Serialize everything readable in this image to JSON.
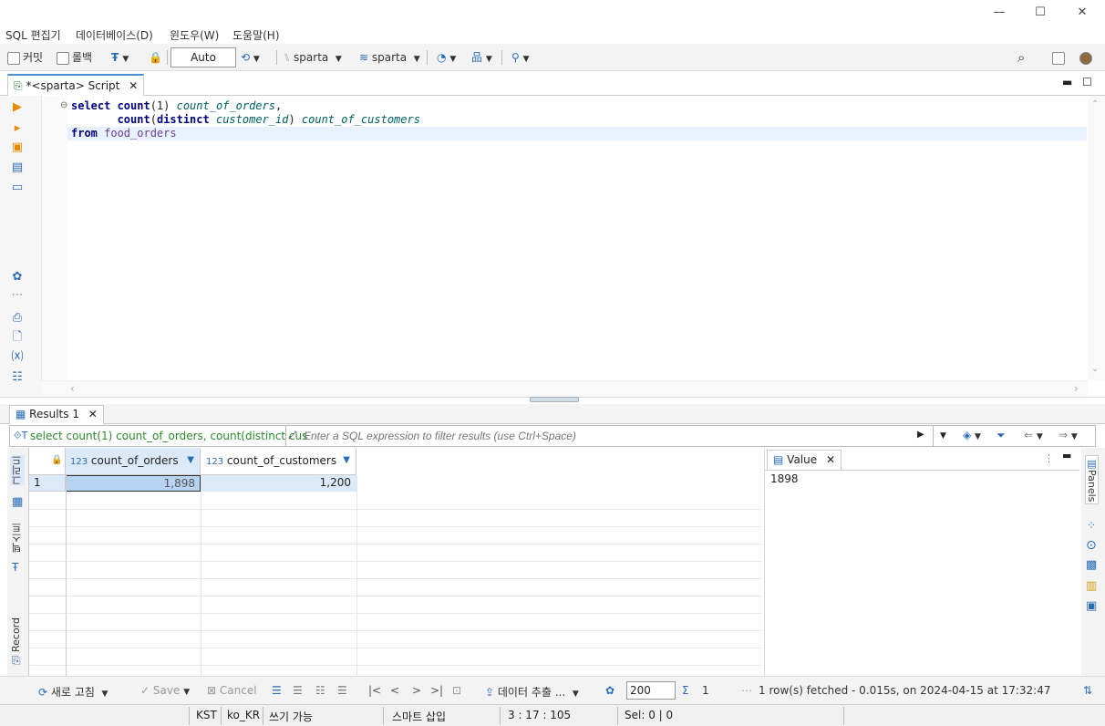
{
  "window": {
    "minimize": "—",
    "maximize": "☐",
    "close": "✕"
  },
  "menu": [
    "SQL 편집기",
    "데이터베이스(D)",
    "윈도우(W)",
    "도움말(H)"
  ],
  "toolbar": {
    "commit": "커밋",
    "rollback": "롤백",
    "mode": "Auto",
    "datasource": "sparta",
    "schema": "sparta"
  },
  "editor": {
    "tab_title": "*<sparta> Script",
    "lines": [
      {
        "kw1": "select ",
        "fn": "count",
        "args": "(1) ",
        "alias": "count_of_orders",
        "tail": ","
      },
      {
        "indent": "       ",
        "fn": "count",
        "paren": "(",
        "kw": "distinct ",
        "col": "customer_id",
        "close": ") ",
        "alias": "count_of_customers"
      },
      {
        "kw": "from ",
        "table": "food_orders"
      }
    ]
  },
  "results": {
    "tab_title": "Results 1",
    "filter_query": "select count(1) count_of_orders, count(distinct cus",
    "filter_placeholder": "Enter a SQL expression to filter results (use Ctrl+Space)",
    "columns": [
      {
        "type": "123",
        "name": "count_of_orders"
      },
      {
        "type": "123",
        "name": "count_of_customers"
      }
    ],
    "rows": [
      {
        "num": "1",
        "values": [
          "1,898",
          "1,200"
        ]
      }
    ],
    "side_tabs": [
      "그리드",
      "텍스트",
      "Record"
    ]
  },
  "value_panel": {
    "title": "Value",
    "value": "1898",
    "panels_label": "Panels"
  },
  "bottom": {
    "refresh": "새로 고침",
    "save": "Save",
    "cancel": "Cancel",
    "export": "데이터 추출 ...",
    "fetch_size": "200",
    "count": "1",
    "fetch_status": "1 row(s) fetched - 0.015s, on 2024-04-15 at 17:32:47"
  },
  "status": {
    "tz": "KST",
    "locale": "ko_KR",
    "writable": "쓰기 가능",
    "insert_mode": "스마트 삽입",
    "position": "3 : 17 : 105",
    "selection": "Sel: 0 | 0"
  },
  "colors": {
    "accent": "#4a90d9",
    "selected_cell": "#b7d3f2",
    "selected_col": "#dce9f8"
  }
}
